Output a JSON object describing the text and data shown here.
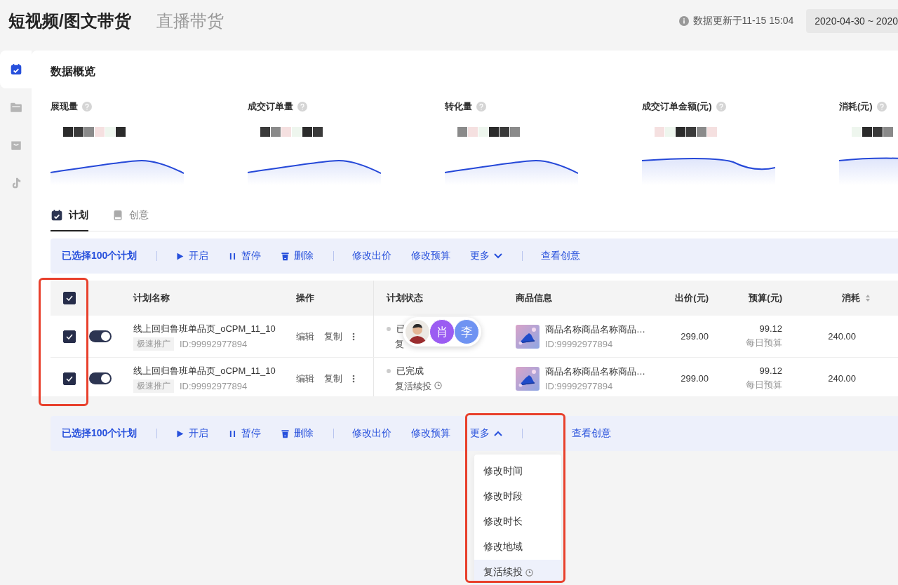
{
  "header": {
    "tabs": [
      {
        "label": "短视频/图文带货",
        "selected": true
      },
      {
        "label": "直播带货",
        "selected": false
      }
    ],
    "update_note": "数据更新于11-15 15:04",
    "date_range": "2020-04-30 ~ 2020"
  },
  "sidebar": {
    "items": [
      {
        "kind": "calendar",
        "selected": true
      },
      {
        "kind": "folder",
        "selected": false
      },
      {
        "kind": "tray",
        "selected": false
      },
      {
        "kind": "note",
        "selected": false
      }
    ]
  },
  "overview": {
    "title": "数据概览",
    "metrics": [
      {
        "label": "展现量"
      },
      {
        "label": "成交订单量"
      },
      {
        "label": "转化量"
      },
      {
        "label": "成交订单金额(元)"
      },
      {
        "label": "消耗(元)"
      }
    ]
  },
  "content_tabs": [
    {
      "kind": "calendar",
      "label": "计划",
      "selected": true
    },
    {
      "kind": "tablet",
      "label": "创意",
      "selected": false
    }
  ],
  "action_bar": {
    "selection": "已选择100个计划",
    "controls": [
      {
        "kind": "play",
        "label": "开启"
      },
      {
        "kind": "pause",
        "label": "暂停"
      },
      {
        "kind": "trash",
        "label": "删除"
      }
    ],
    "edits": [
      "修改出价",
      "修改预算"
    ],
    "more": {
      "label": "更多",
      "expanded": false
    },
    "view": "查看创意"
  },
  "table": {
    "header_checked": true,
    "columns": [
      "计划名称",
      "操作",
      "计划状态",
      "商品信息",
      "出价(元)",
      "预算(元)",
      "消耗"
    ],
    "rows": [
      {
        "checked": true,
        "on": true,
        "name": "线上回归鲁班单品页_oCPM_11_10",
        "tag": "极速推广",
        "id": "ID:99992977894",
        "actions": [
          "编辑",
          "复制"
        ],
        "status": "已",
        "status_sub": "复",
        "timed": false,
        "product": "商品名称商品名称商品…",
        "product_id": "ID:99992977894",
        "bid": "299.00",
        "budget": "99.12",
        "budget_note": "每日预算",
        "spend": "240.00",
        "collaborators": [
          {
            "kind": "picture"
          },
          {
            "kind": "initial",
            "initial": "肖",
            "color": "#9b5cf2"
          },
          {
            "kind": "initial",
            "initial": "李",
            "color": "#6f93f2"
          }
        ]
      },
      {
        "checked": true,
        "on": true,
        "name": "线上回归鲁班单品页_oCPM_11_10",
        "tag": "极速推广",
        "id": "ID:99992977894",
        "actions": [
          "编辑",
          "复制"
        ],
        "status": "已完成",
        "status_sub": "复活续投",
        "timed": true,
        "product": "商品名称商品名称商品…",
        "product_id": "ID:99992977894",
        "bid": "299.00",
        "budget": "99.12",
        "budget_note": "每日预算",
        "spend": "240.00"
      }
    ]
  },
  "bottom_action_bar": {
    "selection": "已选择100个计划",
    "controls": [
      {
        "kind": "play",
        "label": "开启"
      },
      {
        "kind": "pause",
        "label": "暂停"
      },
      {
        "kind": "trash",
        "label": "删除"
      }
    ],
    "edits": [
      "修改出价",
      "修改预算"
    ],
    "more": {
      "label": "更多",
      "expanded": true
    },
    "view": "查看创意",
    "menu": [
      {
        "label": "修改时间",
        "selected": false,
        "timed": false
      },
      {
        "label": "修改时段",
        "selected": false,
        "timed": false
      },
      {
        "label": "修改时长",
        "selected": false,
        "timed": false
      },
      {
        "label": "修改地域",
        "selected": false,
        "timed": false
      },
      {
        "label": "复活续投",
        "selected": true,
        "timed": true
      }
    ]
  }
}
